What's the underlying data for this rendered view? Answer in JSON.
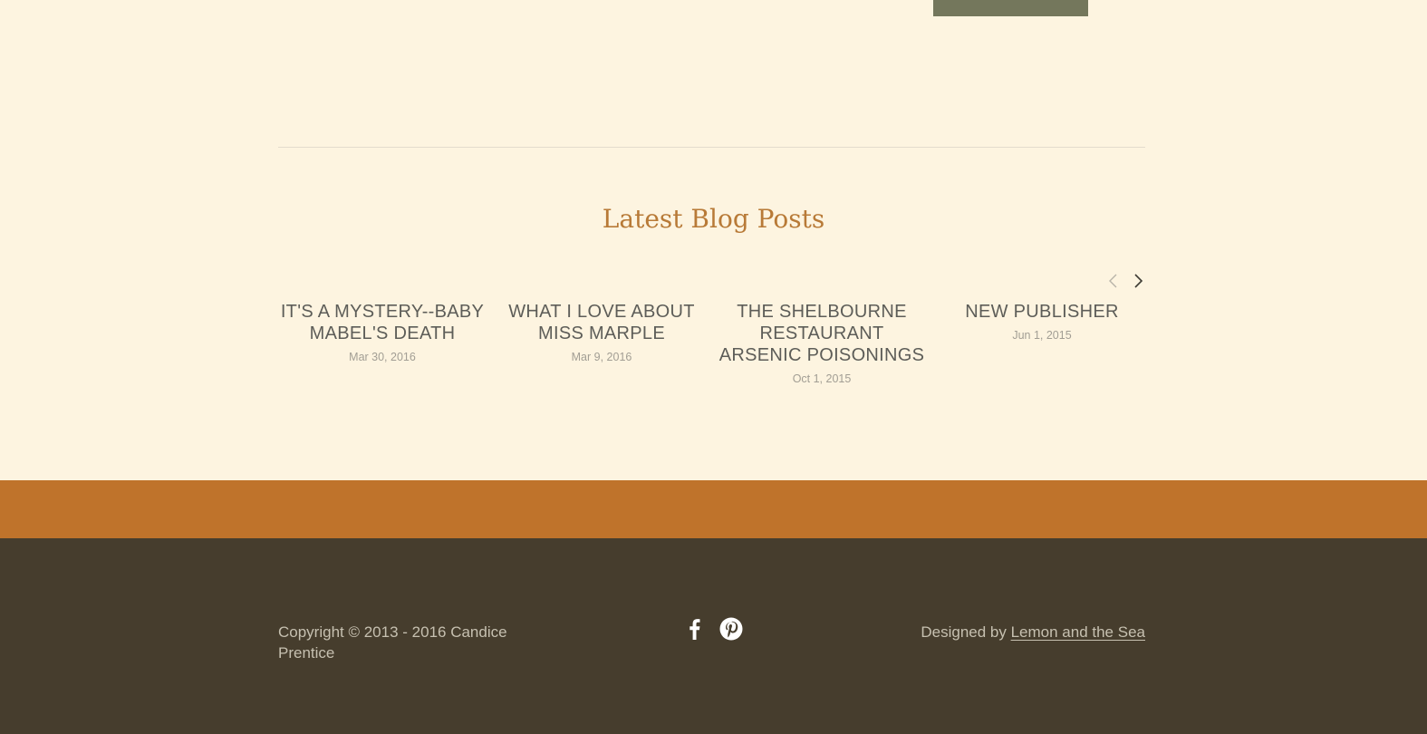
{
  "blog": {
    "heading": "Latest Blog Posts",
    "posts": [
      {
        "title": "IT'S A MYSTERY--BABY MABEL'S DEATH",
        "date": "Mar 30, 2016"
      },
      {
        "title": "WHAT I LOVE ABOUT MISS MARPLE",
        "date": "Mar 9, 2016"
      },
      {
        "title": "THE SHELBOURNE RESTAURANT ARSENIC POISONINGS",
        "date": "Oct 1, 2015"
      },
      {
        "title": "NEW PUBLISHER",
        "date": "Jun 1, 2015"
      }
    ],
    "nav": {
      "prev_icon": "chevron-left-icon",
      "next_icon": "chevron-right-icon"
    }
  },
  "footer": {
    "copyright": "Copyright © 2013 - 2016 Candice Prentice",
    "designed_prefix": "Designed by ",
    "designer_link": "Lemon and the Sea",
    "social": [
      {
        "icon": "facebook-icon"
      },
      {
        "icon": "pinterest-icon"
      }
    ]
  },
  "colors": {
    "background": "#fdf4e0",
    "accent": "#b87a37",
    "band": "#bf732b",
    "footer": "#463d2d",
    "button": "#74775c"
  }
}
